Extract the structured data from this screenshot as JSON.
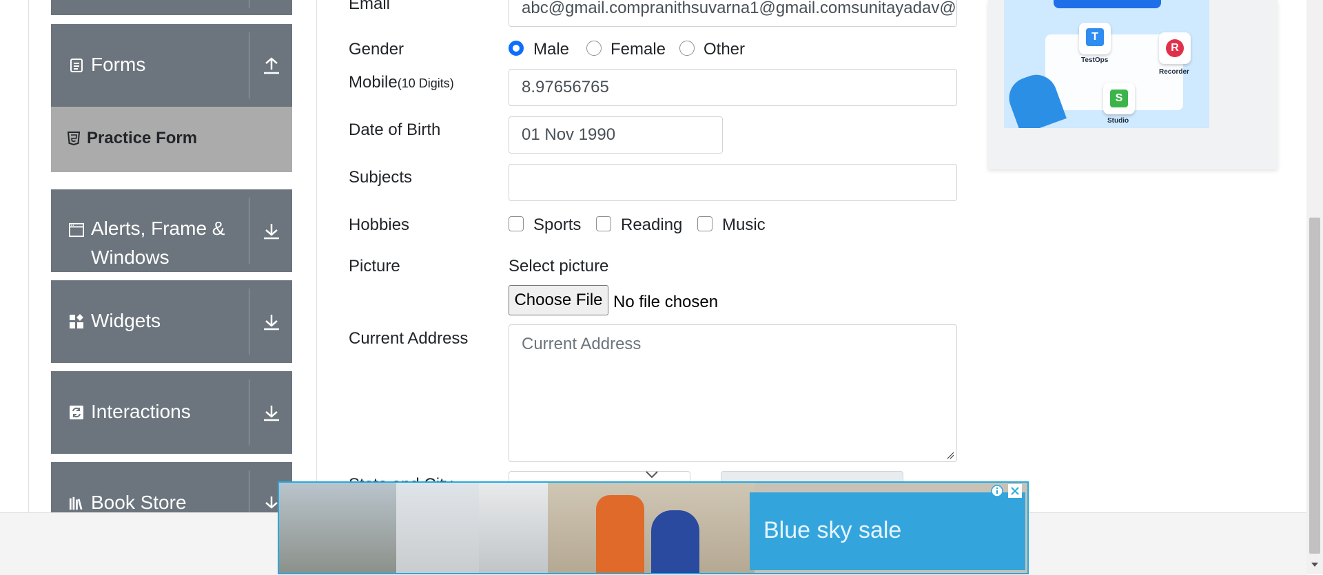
{
  "sidebar": {
    "groups": [
      {
        "label": "Forms",
        "icon": "form-icon",
        "arrow": "upload-arrow-icon"
      },
      {
        "label": "Alerts, Frame & Windows",
        "icon": "window-icon",
        "arrow": "download-arrow-icon"
      },
      {
        "label": "Widgets",
        "icon": "widgets-icon",
        "arrow": "download-arrow-icon"
      },
      {
        "label": "Interactions",
        "icon": "interactions-icon",
        "arrow": "download-arrow-icon"
      },
      {
        "label": "Book Store",
        "icon": "books-icon",
        "arrow": "download-arrow-icon"
      }
    ],
    "active_item": {
      "label": "Practice Form",
      "icon": "html-icon"
    },
    "colors": {
      "group_bg": "#6c757d",
      "active_bg": "#ababab"
    }
  },
  "form": {
    "email": {
      "label": "Email",
      "value": "abc@gmail.compranithsuvarna1@gmail.comsunitayadav@"
    },
    "gender": {
      "label": "Gender",
      "options": [
        "Male",
        "Female",
        "Other"
      ],
      "selected": "Male"
    },
    "mobile": {
      "label": "Mobile",
      "hint": "(10 Digits)",
      "value": "8.97656765"
    },
    "dob": {
      "label": "Date of Birth",
      "value": "01 Nov 1990"
    },
    "subjects": {
      "label": "Subjects",
      "value": ""
    },
    "hobbies": {
      "label": "Hobbies",
      "options": [
        "Sports",
        "Reading",
        "Music"
      ]
    },
    "picture": {
      "label": "Picture",
      "caption": "Select picture",
      "button": "Choose File",
      "status": "No file chosen"
    },
    "address": {
      "label": "Current Address",
      "placeholder": "Current Address"
    },
    "state_city": {
      "label": "State and City"
    },
    "accent": "#0d6efd"
  },
  "ad_card": {
    "labels": [
      "TestOps",
      "Recorder",
      "Studio"
    ]
  },
  "banner": {
    "text": "Blue sky sale",
    "accent": "#25a9e0"
  }
}
